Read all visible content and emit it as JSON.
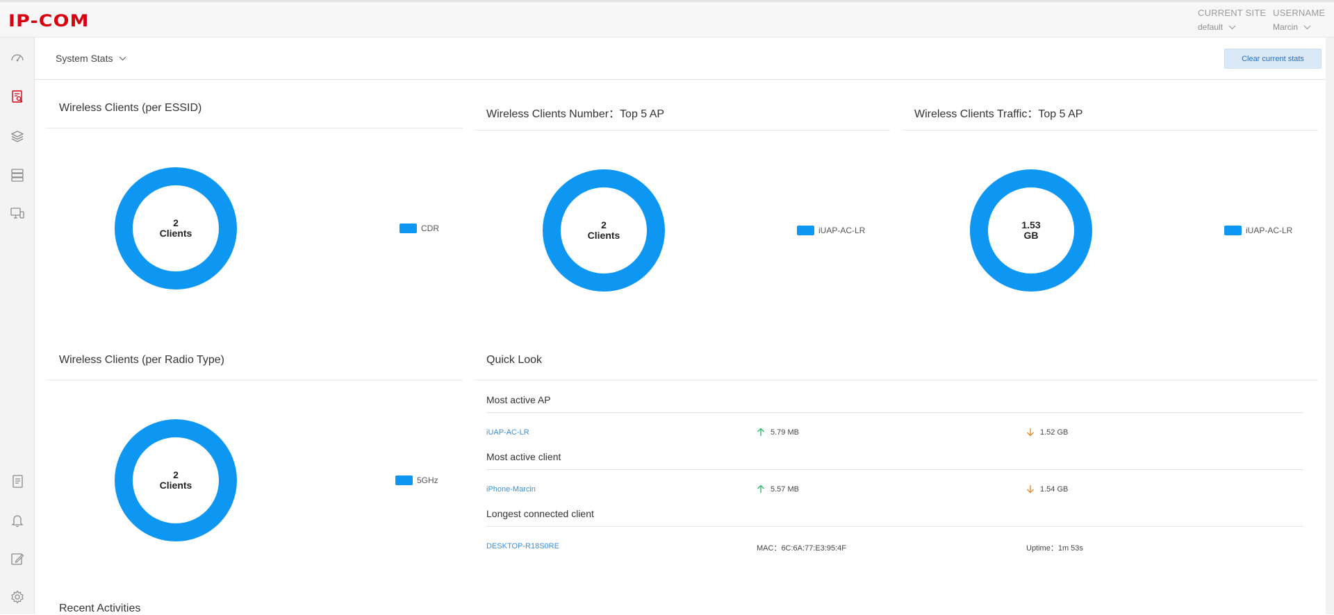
{
  "header": {
    "logo": "IP-COM",
    "current_site_label": "CURRENT SITE",
    "current_site_value": "default",
    "username_label": "USERNAME",
    "username_value": "Marcin"
  },
  "sidebar": {
    "icons": [
      "dashboard-icon",
      "statistics-icon",
      "layers-icon",
      "devices-icon",
      "clients-icon",
      "log-icon",
      "bell-icon",
      "edit-icon",
      "settings-icon"
    ],
    "active_index": 1,
    "active_color": "#d7000f"
  },
  "topbar": {
    "view_label": "System Stats",
    "clear_button": "Clear current stats"
  },
  "panels": {
    "essid": {
      "title": "Wireless Clients (per ESSID)",
      "center_value": "2",
      "center_unit": "Clients",
      "legend": "CDR"
    },
    "top5_number": {
      "title": "Wireless Clients Number：Top 5 AP",
      "center_value": "2",
      "center_unit": "Clients",
      "legend": "iUAP-AC-LR"
    },
    "top5_traffic": {
      "title": "Wireless Clients Traffic：Top 5 AP",
      "center_value": "1.53",
      "center_unit": "GB",
      "legend": "iUAP-AC-LR"
    },
    "radio": {
      "title": "Wireless Clients (per Radio Type)",
      "center_value": "2",
      "center_unit": "Clients",
      "legend": "5GHz"
    }
  },
  "chart_data": [
    {
      "type": "pie",
      "title": "Wireless Clients (per ESSID)",
      "categories": [
        "CDR"
      ],
      "values": [
        2
      ]
    },
    {
      "type": "pie",
      "title": "Wireless Clients Number：Top 5 AP",
      "categories": [
        "iUAP-AC-LR"
      ],
      "values": [
        2
      ]
    },
    {
      "type": "pie",
      "title": "Wireless Clients Traffic：Top 5 AP",
      "categories": [
        "iUAP-AC-LR"
      ],
      "values": [
        1.53
      ]
    },
    {
      "type": "pie",
      "title": "Wireless Clients (per Radio Type)",
      "categories": [
        "5GHz"
      ],
      "values": [
        2
      ]
    }
  ],
  "colors": {
    "donut": "#0d97f3",
    "up_arrow": "#2fb96f",
    "down_arrow": "#e88a2e",
    "link": "#3a8fd9"
  },
  "quick_look": {
    "title": "Quick Look",
    "most_active_ap_label": "Most active AP",
    "most_active_ap": {
      "name": "iUAP-AC-LR",
      "up": "5.79 MB",
      "down": "1.52 GB"
    },
    "most_active_client_label": "Most active client",
    "most_active_client": {
      "name": "iPhone-Marcin",
      "up": "5.57 MB",
      "down": "1.54 GB"
    },
    "longest_client_label": "Longest connected client",
    "longest_client": {
      "name": "DESKTOP-R18S0RE",
      "mac": "MAC：6C:6A:77:E3:95:4F",
      "uptime": "Uptime：1m 53s"
    }
  },
  "recent_activities": "Recent Activities"
}
